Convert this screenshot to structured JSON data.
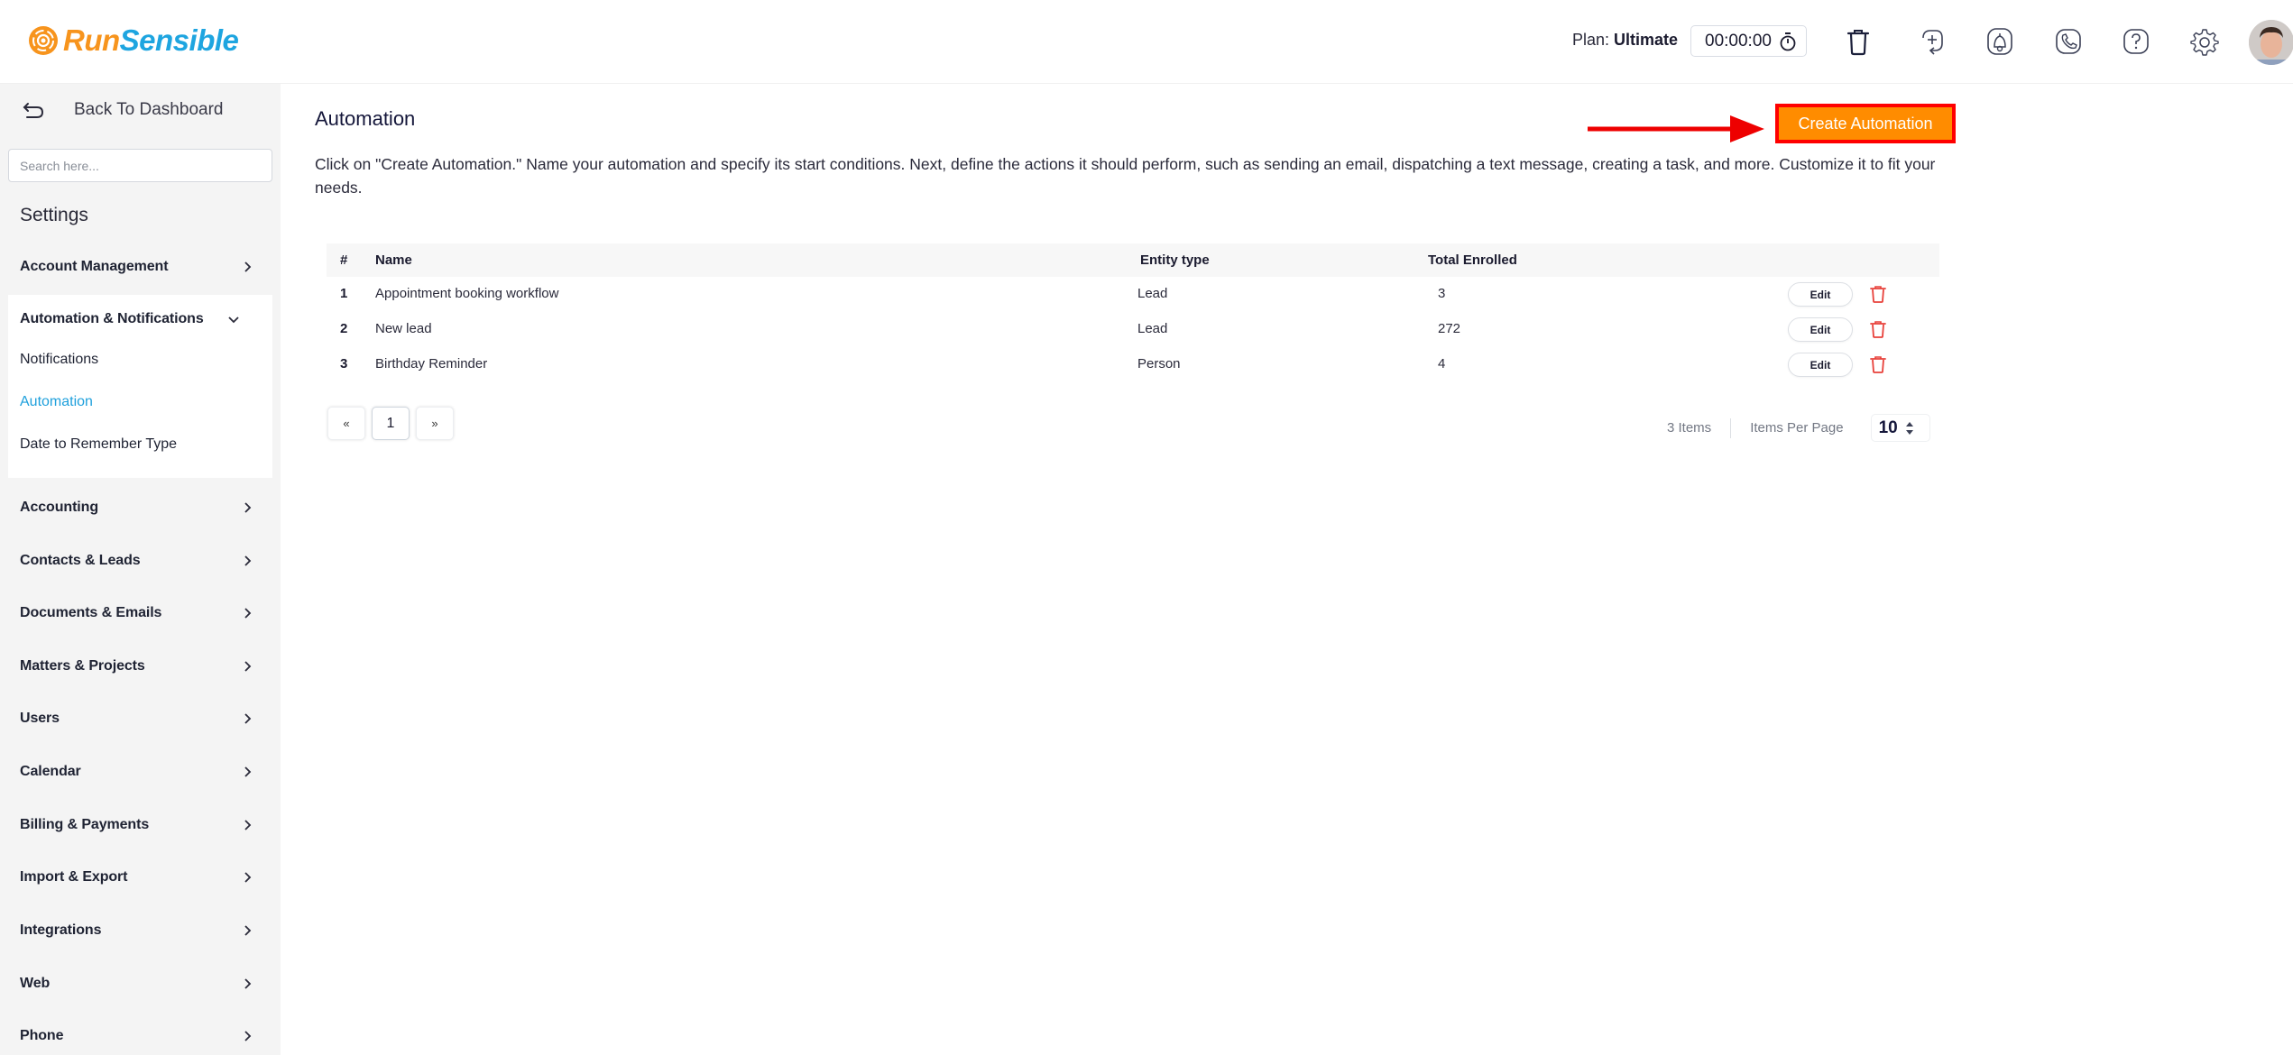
{
  "header": {
    "logo": {
      "part1": "Run",
      "part2": "Sensible",
      "color1": "#f7941d",
      "color2": "#1ea5e0"
    },
    "plan_label": "Plan:",
    "plan_value": "Ultimate",
    "timer_value": "00:00:00",
    "icons": [
      "stopwatch-icon",
      "trash-icon",
      "add-task-icon",
      "notification-bell-icon",
      "phone-icon",
      "help-icon",
      "settings-gear-icon",
      "user-avatar"
    ]
  },
  "sidebar": {
    "back_label": "Back To Dashboard",
    "search_placeholder": "Search here...",
    "settings_title": "Settings",
    "items": [
      {
        "label": "Account Management",
        "expanded": false
      },
      {
        "label": "Automation & Notifications",
        "expanded": true,
        "children": [
          {
            "label": "Notifications",
            "active": false
          },
          {
            "label": "Automation",
            "active": true
          },
          {
            "label": "Date to Remember Type",
            "active": false
          }
        ]
      },
      {
        "label": "Accounting",
        "expanded": false
      },
      {
        "label": "Contacts & Leads",
        "expanded": false
      },
      {
        "label": "Documents & Emails",
        "expanded": false
      },
      {
        "label": "Matters & Projects",
        "expanded": false
      },
      {
        "label": "Users",
        "expanded": false
      },
      {
        "label": "Calendar",
        "expanded": false
      },
      {
        "label": "Billing & Payments",
        "expanded": false
      },
      {
        "label": "Import & Export",
        "expanded": false
      },
      {
        "label": "Integrations",
        "expanded": false
      },
      {
        "label": "Web",
        "expanded": false
      },
      {
        "label": "Phone",
        "expanded": false
      }
    ],
    "active_color": "#1fa0dc"
  },
  "main": {
    "title": "Automation",
    "description": "Click on \"Create Automation.\" Name your automation and specify its start conditions. Next, define the actions it should perform, such as sending an email, dispatching a text message, creating a task, and more. Customize it to fit your needs.",
    "create_button": "Create Automation",
    "create_button_color": "#ff8c00",
    "highlight_color": "#ff0000",
    "table": {
      "columns": [
        "#",
        "Name",
        "Entity type",
        "Total Enrolled"
      ],
      "rows": [
        {
          "index": "1",
          "name": "Appointment booking workflow",
          "entity_type": "Lead",
          "total_enrolled": "3",
          "edit_label": "Edit"
        },
        {
          "index": "2",
          "name": "New lead",
          "entity_type": "Lead",
          "total_enrolled": "272",
          "edit_label": "Edit"
        },
        {
          "index": "3",
          "name": "Birthday Reminder",
          "entity_type": "Person",
          "total_enrolled": "4",
          "edit_label": "Edit"
        }
      ]
    },
    "pagination": {
      "prev": "«",
      "current_page": "1",
      "next": "»",
      "items_count": "3 Items",
      "per_page_label": "Items Per Page",
      "per_page_value": "10"
    }
  }
}
